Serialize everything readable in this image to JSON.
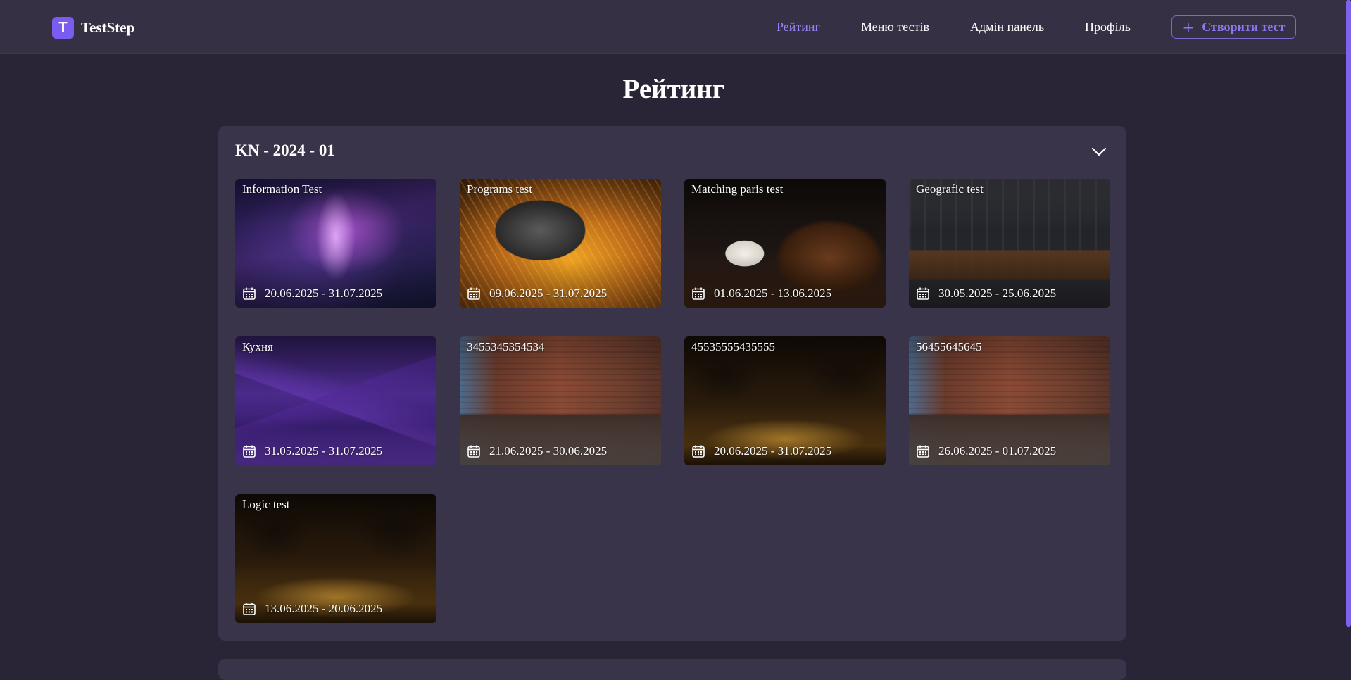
{
  "brand": {
    "logo_letter": "T",
    "name": "TestStep"
  },
  "nav": {
    "items": [
      {
        "label": "Рейтинг",
        "active": true
      },
      {
        "label": "Меню тестів",
        "active": false
      },
      {
        "label": "Адмін панель",
        "active": false
      },
      {
        "label": "Профіль",
        "active": false
      }
    ],
    "create_button": {
      "icon": "plus-icon",
      "label": "Створити тест"
    }
  },
  "page": {
    "title": "Рейтинг"
  },
  "group": {
    "title": "KN - 2024 - 01",
    "toggle_icon": "chevron-down-icon",
    "tests": [
      {
        "title": "Information Test",
        "dates": "20.06.2025 - 31.07.2025",
        "image": "aurora"
      },
      {
        "title": "Programs test",
        "dates": "09.06.2025 - 31.07.2025",
        "image": "cpu"
      },
      {
        "title": "Matching paris test",
        "dates": "01.06.2025 - 13.06.2025",
        "image": "coffee"
      },
      {
        "title": "Geografic test",
        "dates": "30.05.2025 - 25.06.2025",
        "image": "cafe"
      },
      {
        "title": "Кухня",
        "dates": "31.05.2025 - 31.07.2025",
        "image": "mountains"
      },
      {
        "title": "3455345354534",
        "dates": "21.06.2025 - 30.06.2025",
        "image": "brick"
      },
      {
        "title": "45535555435555",
        "dates": "20.06.2025 - 31.07.2025",
        "image": "tree"
      },
      {
        "title": "56455645645",
        "dates": "26.06.2025 - 01.07.2025",
        "image": "brick"
      },
      {
        "title": "Logic test",
        "dates": "13.06.2025 - 20.06.2025",
        "image": "tree"
      }
    ]
  },
  "colors": {
    "background": "#2a2536",
    "navbar": "#353044",
    "panel": "#3a344a",
    "accent": "#7a5cf0",
    "active_link": "#9b82f7"
  }
}
